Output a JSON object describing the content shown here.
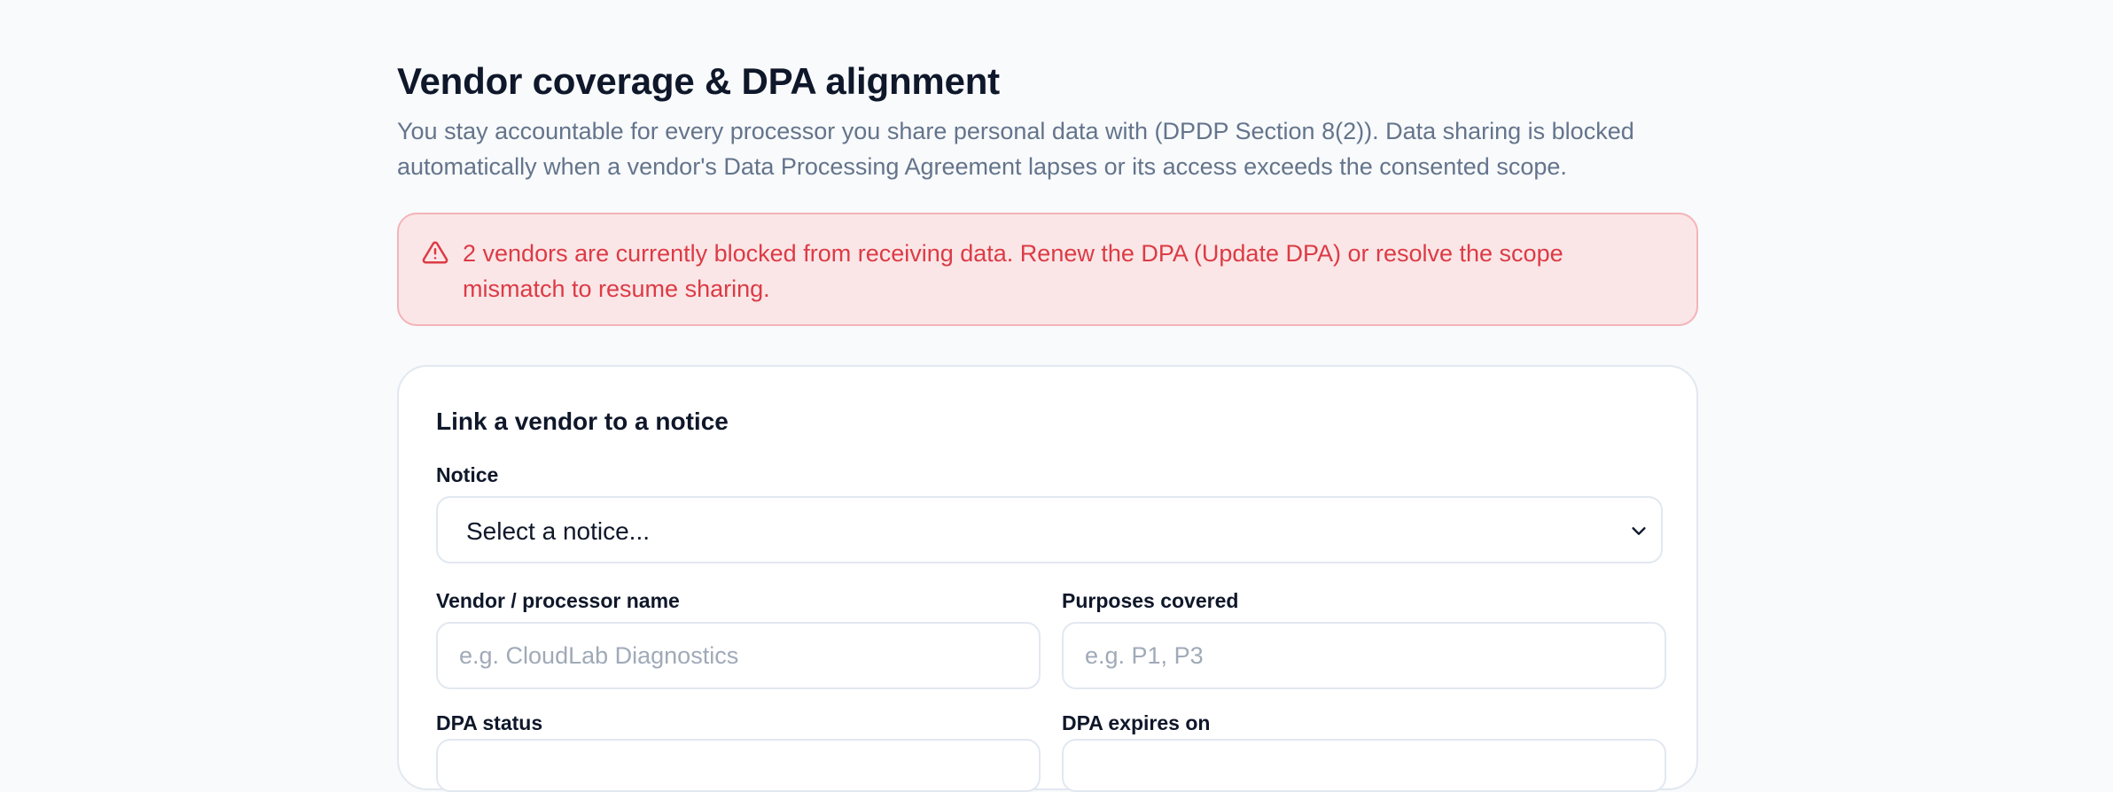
{
  "header": {
    "title": "Vendor coverage & DPA alignment",
    "description": "You stay accountable for every processor you share personal data with (DPDP Section 8(2)). Data sharing is blocked automatically when a vendor's Data Processing Agreement lapses or its access exceeds the consented scope."
  },
  "alert": {
    "icon": "warning-triangle-icon",
    "message": "2 vendors are currently blocked from receiving data. Renew the DPA (Update DPA) or resolve the scope mismatch to resume sharing.",
    "color": "#dc3b45",
    "background": "#fbe6e7"
  },
  "form": {
    "title": "Link a vendor to a notice",
    "notice": {
      "label": "Notice",
      "value": "Select a notice..."
    },
    "vendor_name": {
      "label": "Vendor / processor name",
      "placeholder": "e.g. CloudLab Diagnostics"
    },
    "purposes": {
      "label": "Purposes covered",
      "placeholder": "e.g. P1, P3"
    },
    "dpa_status": {
      "label": "DPA status"
    },
    "dpa_expires": {
      "label": "DPA expires on"
    }
  }
}
